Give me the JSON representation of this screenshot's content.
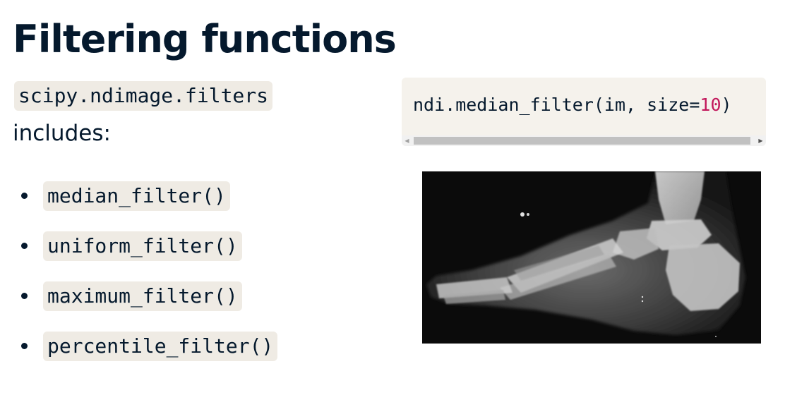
{
  "slide": {
    "title": "Filtering functions",
    "intro": {
      "module": "scipy.ndimage.filters",
      "text": "includes:"
    },
    "functions": [
      "median_filter()",
      "uniform_filter()",
      "maximum_filter()",
      "percentile_filter()"
    ],
    "code_example": {
      "prefix": "ndi.median_filter(im, size=",
      "number": "10",
      "suffix": ")"
    },
    "image": {
      "subject": "foot-xray-image"
    }
  },
  "colors": {
    "text": "#05192d",
    "chip_bg": "#efebe4",
    "code_block_bg": "#f5f2ec",
    "code_number": "#c2185b"
  }
}
